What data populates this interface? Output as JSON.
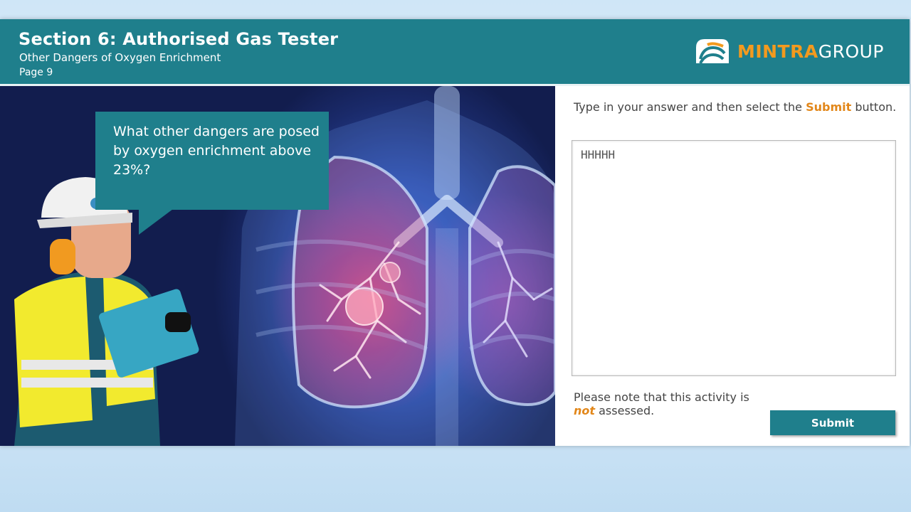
{
  "header": {
    "title": "Section 6: Authorised Gas Tester",
    "subtitle": "Other Dangers of Oxygen Enrichment",
    "page": "Page 9",
    "logo_text_a": "MINTRA",
    "logo_text_b": "GROUP"
  },
  "scene": {
    "question": "What other dangers are posed by oxygen enrichment above 23%?",
    "illustration": "gas-tester-worker-with-tablet",
    "background": "lungs-xray"
  },
  "panel": {
    "instruction_pre": "Type in your answer and then select the ",
    "instruction_bold": "Submit",
    "instruction_post": " button.",
    "answer_value": "HHHHH",
    "note_pre": "Please note that this activity is ",
    "note_em": "not",
    "note_post": " assessed.",
    "submit_label": "Submit"
  },
  "colors": {
    "teal": "#1f7f8c",
    "orange": "#f39a1e"
  }
}
